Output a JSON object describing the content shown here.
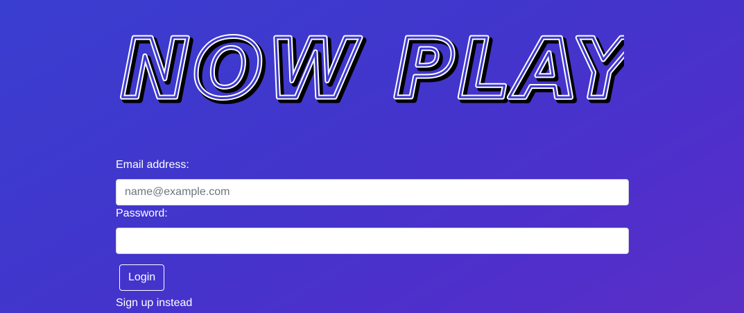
{
  "app": {
    "logo_text": "NOW PLAYING"
  },
  "login_form": {
    "email_label": "Email address:",
    "email_placeholder": "name@example.com",
    "email_value": "",
    "password_label": "Password:",
    "password_value": "",
    "login_button_label": "Login",
    "signup_link_label": "Sign up instead"
  },
  "colors": {
    "background_start": "#3a3ed0",
    "background_end": "#5a2fc6",
    "text": "#ffffff"
  }
}
